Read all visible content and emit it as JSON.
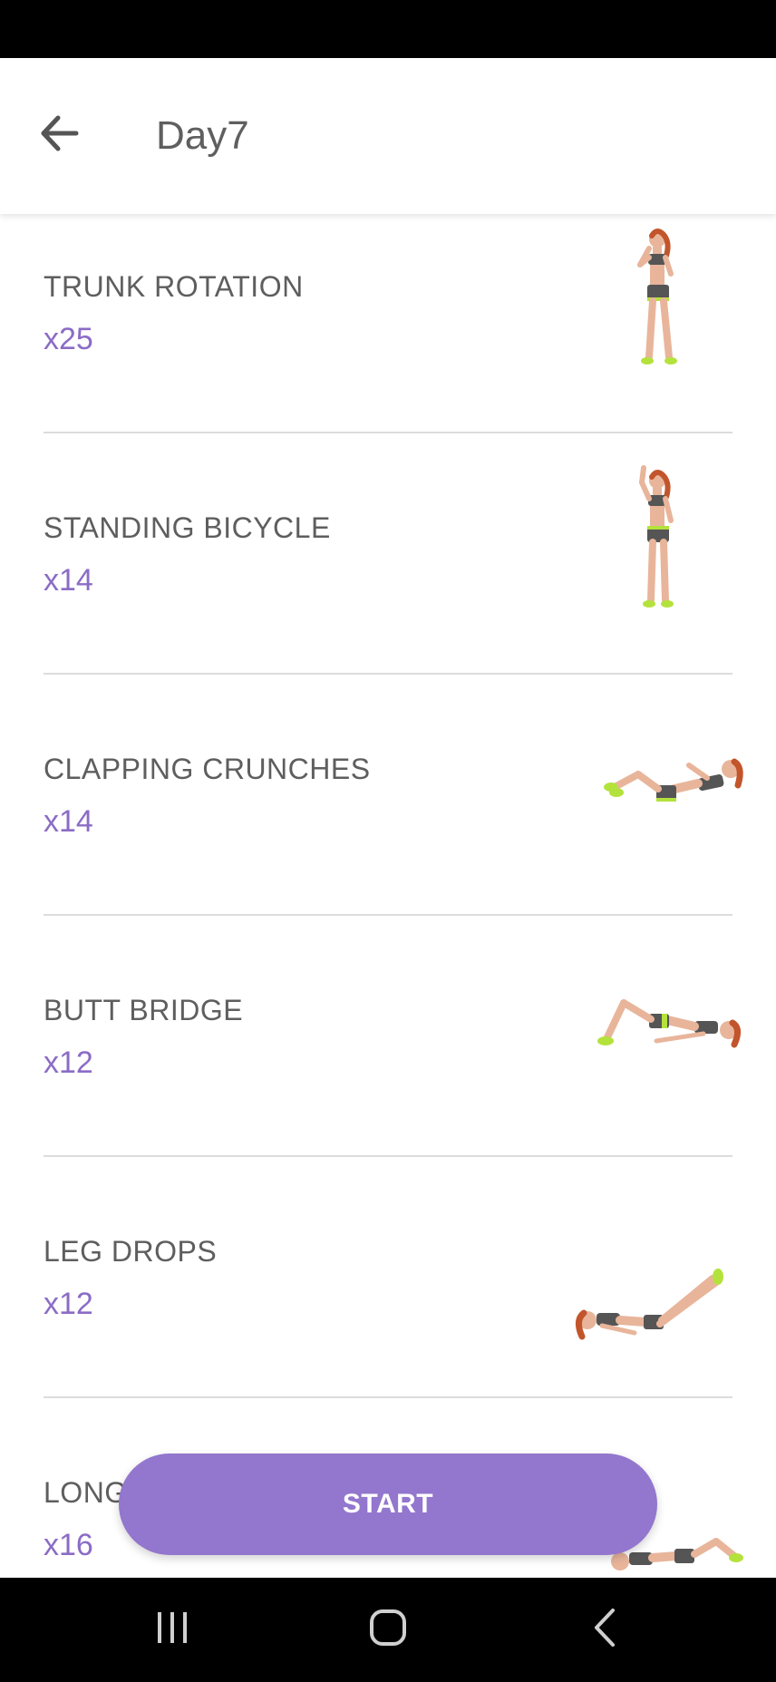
{
  "header": {
    "title": "Day7"
  },
  "exercises": [
    {
      "name": "TRUNK ROTATION",
      "reps": "x25",
      "pose": "standing-arms-bent"
    },
    {
      "name": "STANDING BICYCLE",
      "reps": "x14",
      "pose": "standing-arm-raised"
    },
    {
      "name": "CLAPPING CRUNCHES",
      "reps": "x14",
      "pose": "lying-crunch"
    },
    {
      "name": "BUTT BRIDGE",
      "reps": "x12",
      "pose": "lying-bridge"
    },
    {
      "name": "LEG DROPS",
      "reps": "x12",
      "pose": "lying-legs-up"
    },
    {
      "name": "LONG",
      "reps": "x16",
      "pose": "lying-flat"
    }
  ],
  "start_button": {
    "label": "START"
  },
  "colors": {
    "accent": "#9376cd",
    "reps_text": "#8b6cc6",
    "title_text": "#5f5f5f"
  },
  "nav": {
    "icons": [
      "recent-apps-icon",
      "home-icon",
      "back-nav-icon"
    ]
  }
}
